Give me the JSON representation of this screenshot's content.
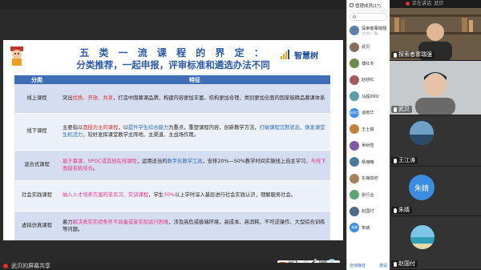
{
  "slide": {
    "title": "五 类 一 流 课 程 的 界 定 ：",
    "subtitle": "分类推荐，一起申报，评审标准和遴选办法不同",
    "logo_text": "智慧树",
    "header_col1": "分类",
    "header_col2": "特征",
    "rows": [
      {
        "cat": "线上课程",
        "segments": [
          {
            "t": "突出",
            "c": "dark"
          },
          {
            "t": "优质、开放、共享",
            "c": "red"
          },
          {
            "t": "，打造中国慕课品牌，构建内容更加丰富、结构更加合理、类别更加全面的国家级精品慕课体系",
            "c": "dark"
          }
        ]
      },
      {
        "cat": "线下课程",
        "segments": [
          {
            "t": "主要指以",
            "c": "dark"
          },
          {
            "t": "面授为主的课程",
            "c": "red"
          },
          {
            "t": "，以",
            "c": "dark"
          },
          {
            "t": "提升学生综合能力",
            "c": "blue"
          },
          {
            "t": "为重点，重塑课程内容，创新教学方法，",
            "c": "dark"
          },
          {
            "t": "打破课程沉默状态，焕发课堂生机活力",
            "c": "blue"
          },
          {
            "t": "，较好发挥课堂教学主阵地、主渠道、主战场作用。",
            "c": "dark"
          }
        ]
      },
      {
        "cat": "混合式课程",
        "segments": [
          {
            "t": "基于慕课、SPOC或其他在线课程",
            "c": "pink"
          },
          {
            "t": "，运用适当的",
            "c": "dark"
          },
          {
            "t": "数字化教学工具",
            "c": "blue"
          },
          {
            "t": "，安排20%—50%教学时间实施线上自主学习，",
            "c": "dark"
          },
          {
            "t": "与线下面授有机结合",
            "c": "pink"
          },
          {
            "t": "。",
            "c": "dark"
          }
        ]
      },
      {
        "cat": "社会实践课程",
        "segments": [
          {
            "t": "纳入人才培养方案的非实习、实训课程",
            "c": "pink"
          },
          {
            "t": "，学生",
            "c": "dark"
          },
          {
            "t": "70%",
            "c": "pink"
          },
          {
            "t": "以上学时深入基层进行社会实践认识，理解服务社会。",
            "c": "dark"
          }
        ]
      },
      {
        "cat": "虚拟仿真课程",
        "segments": [
          {
            "t": "着力",
            "c": "dark"
          },
          {
            "t": "解决真实实验条件不具备或者实际运行困难",
            "c": "pink"
          },
          {
            "t": "，涉及高危或极端环境，高成本、高消耗、不可逆操作、大型综合训练等问题。",
            "c": "dark"
          }
        ]
      }
    ]
  },
  "toolbar": {
    "sogou_label": "中 •，☺ 🎤 ⌨ 👕 ⋯"
  },
  "status": {
    "sharer": "武贝的屏幕共享"
  },
  "members": {
    "header": "管理成员(17)",
    "search_placeholder": "搜索成员",
    "list": [
      {
        "name": "探索者寨瑞强",
        "sub": "(主持人, 我)",
        "color": "#5b7fa6",
        "text": ""
      },
      {
        "name": "武贝",
        "color": "#8a6d5a",
        "text": ""
      },
      {
        "name": "傅红冬",
        "color": "#6c8a4a",
        "text": ""
      },
      {
        "name": "赵晓红",
        "color": "#a65b5b",
        "text": ""
      },
      {
        "name": "马超2002",
        "color": "#5b9ea6",
        "text": ""
      },
      {
        "name": "谈雨华",
        "color": "#3a8de0",
        "text": "谈雨华"
      },
      {
        "name": "王士娟",
        "color": "#c77f3a",
        "text": ""
      },
      {
        "name": "吴树雪",
        "color": "#7a5ba6",
        "text": ""
      },
      {
        "name": "杨瑞曦",
        "color": "#4a7a9e",
        "text": ""
      },
      {
        "name": "东梅如初",
        "color": "#a6825b",
        "text": ""
      },
      {
        "name": "张行业",
        "color": "#5ba675",
        "text": ""
      },
      {
        "name": "赵国付",
        "color": "#4e6a8a",
        "text": ""
      },
      {
        "name": "朱婧",
        "color": "#3a8de0",
        "text": "朱婧"
      }
    ],
    "footer_left": "全体静音",
    "footer_right": "邀请"
  },
  "videos": {
    "top_text": "正在讲话: 武贝",
    "tiles": [
      {
        "name": "探索者寨瑞强"
      },
      {
        "name": "武贝"
      },
      {
        "name": "王江涛"
      },
      {
        "name": "朱婧",
        "avatar_text": "朱婧"
      },
      {
        "name": "赵国付"
      }
    ]
  }
}
